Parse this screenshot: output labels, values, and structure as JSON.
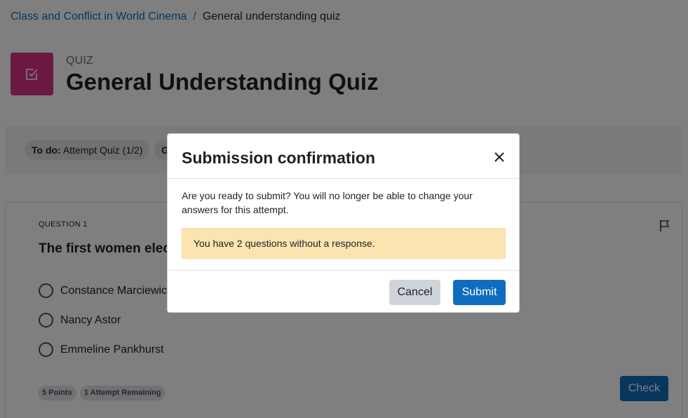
{
  "breadcrumb": {
    "course": "Class and Conflict in World Cinema",
    "separator": "/",
    "current": "General understanding quiz"
  },
  "header": {
    "icon": "checkbox-icon",
    "activity_type": "QUIZ",
    "title": "General Understanding Quiz"
  },
  "completion": {
    "todo_label": "To do:",
    "todo_value": "Attempt Quiz (1/2)",
    "second_pill_visible": "G"
  },
  "question": {
    "number_label": "QUESTION 1",
    "text_visible": "The first women elec",
    "options": [
      "Constance Marciewic",
      "Nancy Astor",
      "Emmeline Pankhurst"
    ],
    "points_badge": "5 Points",
    "attempts_badge": "1 Attempt Remaining",
    "check_label": "Check",
    "flag_icon": "flag-icon"
  },
  "modal": {
    "title": "Submission confirmation",
    "message": "Are you ready to submit? You will no longer be able to change your answers for this attempt.",
    "warning": "You have 2 questions without a response.",
    "cancel_label": "Cancel",
    "submit_label": "Submit",
    "close_icon": "close-icon"
  },
  "colors": {
    "accent": "#0f6cbf",
    "quiz_icon_bg": "#d63384",
    "warning_bg": "#fce4b0",
    "cancel_bg": "#ced4da"
  }
}
